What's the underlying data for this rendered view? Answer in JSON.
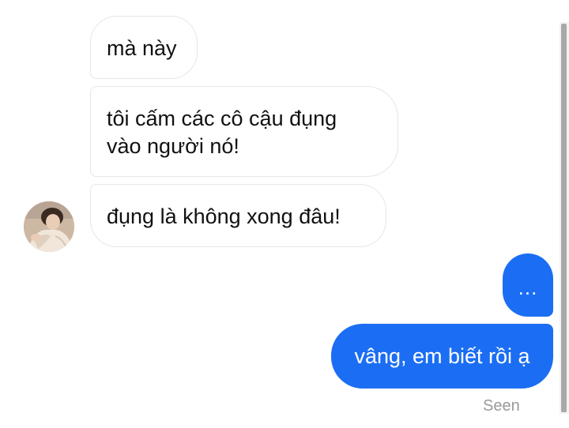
{
  "conversation": {
    "messages": [
      {
        "direction": "incoming",
        "text": "mà này"
      },
      {
        "direction": "incoming",
        "text": "tôi cấm các cô cậu đụng\nvào người nó!"
      },
      {
        "direction": "incoming",
        "text": "đụng là không xong đâu!"
      },
      {
        "direction": "outgoing",
        "text": "..."
      },
      {
        "direction": "outgoing",
        "text": "vâng, em biết rồi ạ"
      }
    ],
    "status": "Seen"
  },
  "contact": {
    "avatar_icon": "profile-photo-avatar"
  },
  "colors": {
    "outgoing_bubble": "#1b6ef3",
    "incoming_bubble": "#ffffff",
    "incoming_border": "#e6e6e6",
    "status_text": "#9a9a9a"
  }
}
